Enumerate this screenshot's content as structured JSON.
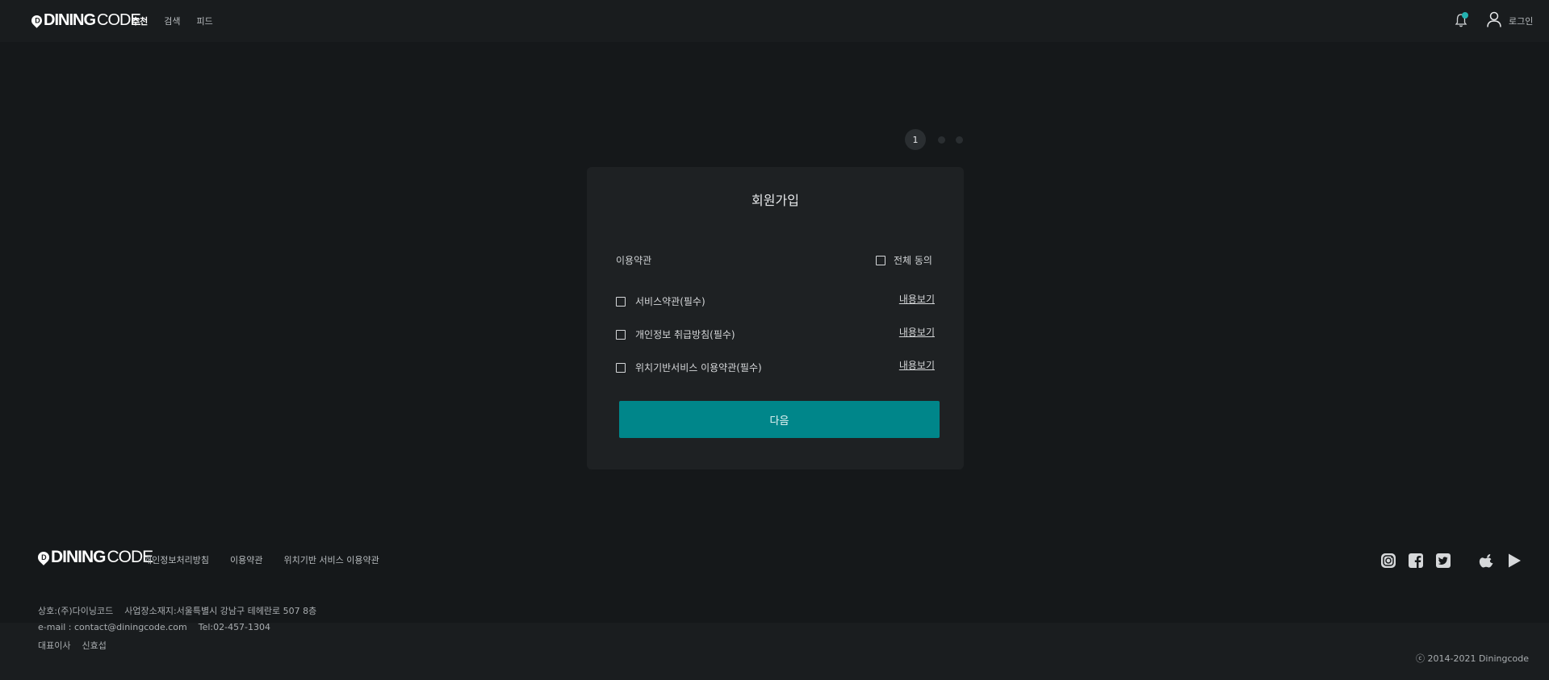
{
  "header": {
    "logo": {
      "mark": "D",
      "word_bold": "DINING",
      "word_light": "CODE"
    },
    "nav": [
      {
        "label": "추천"
      },
      {
        "label": "검색"
      },
      {
        "label": "피드"
      }
    ],
    "login_label": "로그인"
  },
  "steps": {
    "current": "1",
    "total": 3
  },
  "signup": {
    "title": "회원가입",
    "section_label": "이용약관",
    "all_agree_label": "전체 동의",
    "terms": [
      {
        "label": "서비스약관(필수)",
        "view_label": "내용보기"
      },
      {
        "label": "개인정보 취급방침(필수)",
        "view_label": "내용보기"
      },
      {
        "label": "위치기반서비스 이용약관(필수)",
        "view_label": "내용보기"
      }
    ],
    "next_label": "다음"
  },
  "footer": {
    "logo": {
      "mark": "D",
      "word_bold": "DINING",
      "word_light": "CODE"
    },
    "links": [
      {
        "label": "개인정보처리방침"
      },
      {
        "label": "이용약관"
      },
      {
        "label": "위치기반 서비스 이용약관"
      }
    ],
    "company": "상호:(주)다이닝코드",
    "address": "사업장소재지:서울특별시 강남구 테헤란로 507 8층",
    "email": "e-mail : contact@diningcode.com",
    "tel": "Tel:02-457-1304",
    "ceo_label": "대표이사",
    "ceo_name": "신효섭",
    "copyright": "ⓒ 2014-2021 Diningcode"
  },
  "colors": {
    "background": "#15181a",
    "card": "#1e2123",
    "accent": "#00868a",
    "badge": "#24b3b1"
  },
  "icons": [
    "bell-icon",
    "user-icon",
    "instagram-icon",
    "facebook-icon",
    "twitter-icon",
    "apple-icon",
    "google-play-icon"
  ]
}
